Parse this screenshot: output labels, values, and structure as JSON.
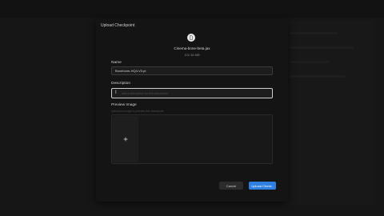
{
  "dialog": {
    "title": "Upload Checkpoint",
    "file": {
      "name": "Cinema-bone-beta.jax",
      "size": "102.36 MB"
    },
    "name_field": {
      "label": "Name",
      "value": "Bonebone-HQ4-V3.pt"
    },
    "description_field": {
      "label": "Description",
      "placeholder": "Add a description for this checkpoint"
    },
    "preview": {
      "label": "Preview Image",
      "hint": "Upload an image to preview this checkpoint"
    },
    "buttons": {
      "cancel": "Cancel",
      "upload": "Upload Check.."
    }
  },
  "icons": {
    "file": "file-icon",
    "add_image": "plus-icon",
    "text_cursor": "text-cursor-icon"
  },
  "colors": {
    "primary": "#2f7fe0",
    "modal_bg": "#141414"
  }
}
